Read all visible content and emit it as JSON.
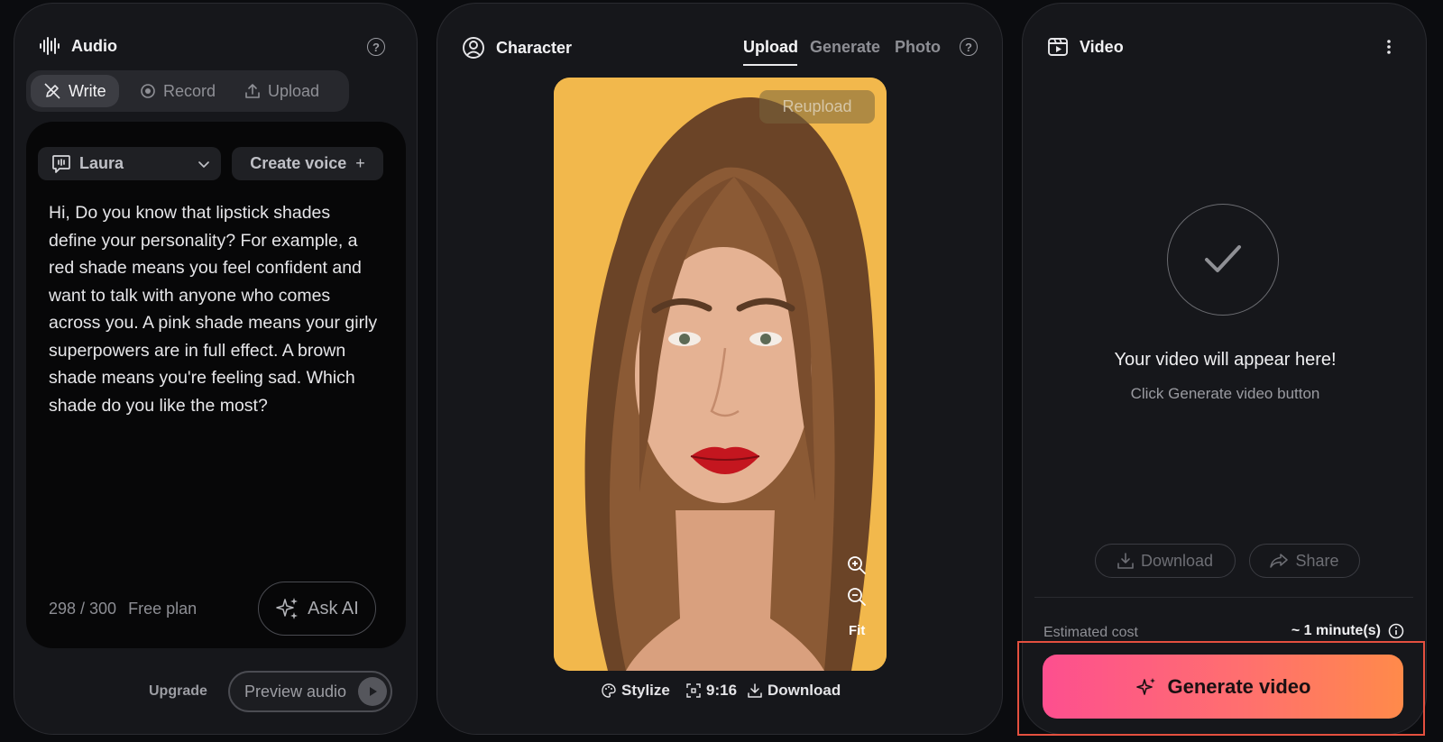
{
  "audio": {
    "title": "Audio",
    "tabs": [
      {
        "label": "Write",
        "icon": "pencil-off-icon",
        "active": true
      },
      {
        "label": "Record",
        "icon": "record-icon",
        "active": false
      },
      {
        "label": "Upload",
        "icon": "upload-icon",
        "active": false
      }
    ],
    "voice": "Laura",
    "create_voice": "Create voice",
    "script": "Hi, Do you know that lipstick shades define your personality? For example, a red shade means you feel confident and want to talk with anyone who comes across you. A pink shade means your girly superpowers are in full effect. A brown shade means you're feeling sad. Which shade do you like the most?",
    "counter": "298 / 300",
    "plan": "Free plan",
    "ask_ai": "Ask AI",
    "upgrade": "Upgrade",
    "preview_audio": "Preview audio"
  },
  "character": {
    "title": "Character",
    "tabs": [
      {
        "label": "Upload",
        "active": true
      },
      {
        "label": "Generate",
        "active": false
      },
      {
        "label": "Photo",
        "active": false
      }
    ],
    "reupload": "Reupload",
    "fit": "Fit",
    "stylize": "Stylize",
    "ratio": "9:16",
    "download": "Download"
  },
  "video": {
    "title": "Video",
    "placeholder_title": "Your video will appear here!",
    "placeholder_sub": "Click Generate video button",
    "download": "Download",
    "share": "Share",
    "estimated_label": "Estimated cost",
    "estimated_value": "~ 1 minute(s)",
    "generate": "Generate video"
  },
  "colors": {
    "accent_start": "#fd4f8f",
    "accent_end": "#ff8a4a",
    "highlight": "#e4503f",
    "photo_bg": "#f2b84c"
  }
}
